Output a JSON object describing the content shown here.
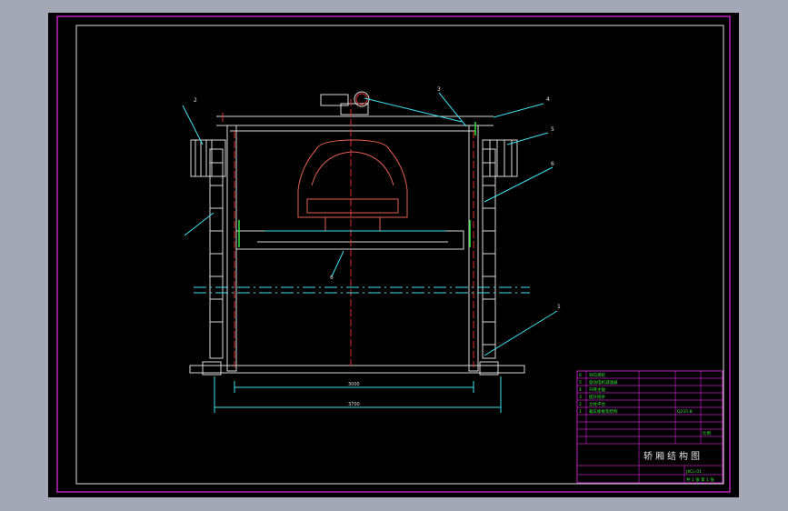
{
  "callouts": [
    "1",
    "2",
    "3",
    "4",
    "5",
    "6",
    "6"
  ],
  "dimensions": {
    "inner": "3000",
    "outer": "3700"
  },
  "title_block": {
    "drawing_title": "轿厢结构图",
    "bom_rows": [
      {
        "no": "6",
        "name": "导向滑轮"
      },
      {
        "no": "5",
        "name": "驱动电机减速器"
      },
      {
        "no": "4",
        "name": "升降主轴"
      },
      {
        "no": "3",
        "name": "提升链条"
      },
      {
        "no": "2",
        "name": "立柱平台"
      },
      {
        "no": "1",
        "name": "载车板框架结构"
      }
    ],
    "spec_mark": "Q235-B",
    "scale_label": "比例",
    "sheet_label": "共 1 张 第 1 张",
    "drawing_no": "JXCL-01"
  }
}
